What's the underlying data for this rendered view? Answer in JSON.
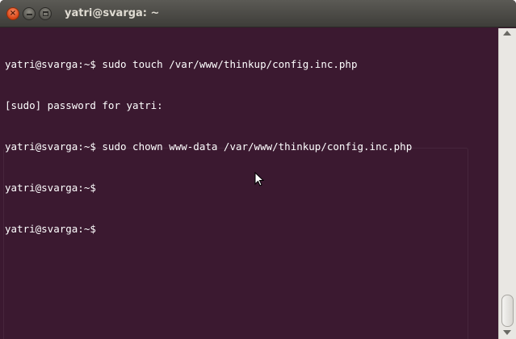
{
  "window": {
    "title": "yatri@svarga: ~",
    "buttons": {
      "close": "×",
      "minimize": "",
      "maximize": ""
    }
  },
  "terminal": {
    "lines": [
      "yatri@svarga:~$ sudo touch /var/www/thinkup/config.inc.php",
      "[sudo] password for yatri:",
      "yatri@svarga:~$ sudo chown www-data /var/www/thinkup/config.inc.php",
      "yatri@svarga:~$",
      "yatri@svarga:~$"
    ],
    "background_color": "#3b1930",
    "text_color": "#ffffff"
  },
  "colors": {
    "close_button": "#d84414",
    "titlebar": "#4c4b47"
  }
}
